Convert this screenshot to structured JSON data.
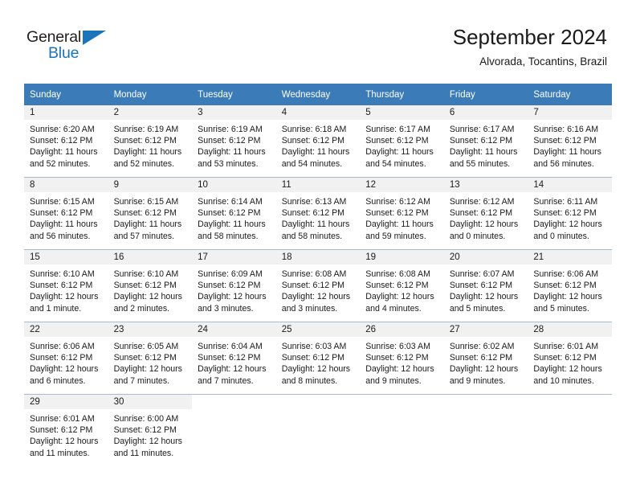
{
  "brand": {
    "name_part1": "General",
    "name_part2": "Blue",
    "accent_color": "#1b75bb"
  },
  "header": {
    "title": "September 2024",
    "location": "Alvorada, Tocantins, Brazil",
    "header_bg_color": "#3b7cb8",
    "daynum_bg_color": "#f1f1f1"
  },
  "weekdays": [
    "Sunday",
    "Monday",
    "Tuesday",
    "Wednesday",
    "Thursday",
    "Friday",
    "Saturday"
  ],
  "weeks": [
    [
      {
        "day": "1",
        "sunrise": "Sunrise: 6:20 AM",
        "sunset": "Sunset: 6:12 PM",
        "daylight1": "Daylight: 11 hours",
        "daylight2": "and 52 minutes."
      },
      {
        "day": "2",
        "sunrise": "Sunrise: 6:19 AM",
        "sunset": "Sunset: 6:12 PM",
        "daylight1": "Daylight: 11 hours",
        "daylight2": "and 52 minutes."
      },
      {
        "day": "3",
        "sunrise": "Sunrise: 6:19 AM",
        "sunset": "Sunset: 6:12 PM",
        "daylight1": "Daylight: 11 hours",
        "daylight2": "and 53 minutes."
      },
      {
        "day": "4",
        "sunrise": "Sunrise: 6:18 AM",
        "sunset": "Sunset: 6:12 PM",
        "daylight1": "Daylight: 11 hours",
        "daylight2": "and 54 minutes."
      },
      {
        "day": "5",
        "sunrise": "Sunrise: 6:17 AM",
        "sunset": "Sunset: 6:12 PM",
        "daylight1": "Daylight: 11 hours",
        "daylight2": "and 54 minutes."
      },
      {
        "day": "6",
        "sunrise": "Sunrise: 6:17 AM",
        "sunset": "Sunset: 6:12 PM",
        "daylight1": "Daylight: 11 hours",
        "daylight2": "and 55 minutes."
      },
      {
        "day": "7",
        "sunrise": "Sunrise: 6:16 AM",
        "sunset": "Sunset: 6:12 PM",
        "daylight1": "Daylight: 11 hours",
        "daylight2": "and 56 minutes."
      }
    ],
    [
      {
        "day": "8",
        "sunrise": "Sunrise: 6:15 AM",
        "sunset": "Sunset: 6:12 PM",
        "daylight1": "Daylight: 11 hours",
        "daylight2": "and 56 minutes."
      },
      {
        "day": "9",
        "sunrise": "Sunrise: 6:15 AM",
        "sunset": "Sunset: 6:12 PM",
        "daylight1": "Daylight: 11 hours",
        "daylight2": "and 57 minutes."
      },
      {
        "day": "10",
        "sunrise": "Sunrise: 6:14 AM",
        "sunset": "Sunset: 6:12 PM",
        "daylight1": "Daylight: 11 hours",
        "daylight2": "and 58 minutes."
      },
      {
        "day": "11",
        "sunrise": "Sunrise: 6:13 AM",
        "sunset": "Sunset: 6:12 PM",
        "daylight1": "Daylight: 11 hours",
        "daylight2": "and 58 minutes."
      },
      {
        "day": "12",
        "sunrise": "Sunrise: 6:12 AM",
        "sunset": "Sunset: 6:12 PM",
        "daylight1": "Daylight: 11 hours",
        "daylight2": "and 59 minutes."
      },
      {
        "day": "13",
        "sunrise": "Sunrise: 6:12 AM",
        "sunset": "Sunset: 6:12 PM",
        "daylight1": "Daylight: 12 hours",
        "daylight2": "and 0 minutes."
      },
      {
        "day": "14",
        "sunrise": "Sunrise: 6:11 AM",
        "sunset": "Sunset: 6:12 PM",
        "daylight1": "Daylight: 12 hours",
        "daylight2": "and 0 minutes."
      }
    ],
    [
      {
        "day": "15",
        "sunrise": "Sunrise: 6:10 AM",
        "sunset": "Sunset: 6:12 PM",
        "daylight1": "Daylight: 12 hours",
        "daylight2": "and 1 minute."
      },
      {
        "day": "16",
        "sunrise": "Sunrise: 6:10 AM",
        "sunset": "Sunset: 6:12 PM",
        "daylight1": "Daylight: 12 hours",
        "daylight2": "and 2 minutes."
      },
      {
        "day": "17",
        "sunrise": "Sunrise: 6:09 AM",
        "sunset": "Sunset: 6:12 PM",
        "daylight1": "Daylight: 12 hours",
        "daylight2": "and 3 minutes."
      },
      {
        "day": "18",
        "sunrise": "Sunrise: 6:08 AM",
        "sunset": "Sunset: 6:12 PM",
        "daylight1": "Daylight: 12 hours",
        "daylight2": "and 3 minutes."
      },
      {
        "day": "19",
        "sunrise": "Sunrise: 6:08 AM",
        "sunset": "Sunset: 6:12 PM",
        "daylight1": "Daylight: 12 hours",
        "daylight2": "and 4 minutes."
      },
      {
        "day": "20",
        "sunrise": "Sunrise: 6:07 AM",
        "sunset": "Sunset: 6:12 PM",
        "daylight1": "Daylight: 12 hours",
        "daylight2": "and 5 minutes."
      },
      {
        "day": "21",
        "sunrise": "Sunrise: 6:06 AM",
        "sunset": "Sunset: 6:12 PM",
        "daylight1": "Daylight: 12 hours",
        "daylight2": "and 5 minutes."
      }
    ],
    [
      {
        "day": "22",
        "sunrise": "Sunrise: 6:06 AM",
        "sunset": "Sunset: 6:12 PM",
        "daylight1": "Daylight: 12 hours",
        "daylight2": "and 6 minutes."
      },
      {
        "day": "23",
        "sunrise": "Sunrise: 6:05 AM",
        "sunset": "Sunset: 6:12 PM",
        "daylight1": "Daylight: 12 hours",
        "daylight2": "and 7 minutes."
      },
      {
        "day": "24",
        "sunrise": "Sunrise: 6:04 AM",
        "sunset": "Sunset: 6:12 PM",
        "daylight1": "Daylight: 12 hours",
        "daylight2": "and 7 minutes."
      },
      {
        "day": "25",
        "sunrise": "Sunrise: 6:03 AM",
        "sunset": "Sunset: 6:12 PM",
        "daylight1": "Daylight: 12 hours",
        "daylight2": "and 8 minutes."
      },
      {
        "day": "26",
        "sunrise": "Sunrise: 6:03 AM",
        "sunset": "Sunset: 6:12 PM",
        "daylight1": "Daylight: 12 hours",
        "daylight2": "and 9 minutes."
      },
      {
        "day": "27",
        "sunrise": "Sunrise: 6:02 AM",
        "sunset": "Sunset: 6:12 PM",
        "daylight1": "Daylight: 12 hours",
        "daylight2": "and 9 minutes."
      },
      {
        "day": "28",
        "sunrise": "Sunrise: 6:01 AM",
        "sunset": "Sunset: 6:12 PM",
        "daylight1": "Daylight: 12 hours",
        "daylight2": "and 10 minutes."
      }
    ],
    [
      {
        "day": "29",
        "sunrise": "Sunrise: 6:01 AM",
        "sunset": "Sunset: 6:12 PM",
        "daylight1": "Daylight: 12 hours",
        "daylight2": "and 11 minutes."
      },
      {
        "day": "30",
        "sunrise": "Sunrise: 6:00 AM",
        "sunset": "Sunset: 6:12 PM",
        "daylight1": "Daylight: 12 hours",
        "daylight2": "and 11 minutes."
      },
      {
        "day": "",
        "sunrise": "",
        "sunset": "",
        "daylight1": "",
        "daylight2": ""
      },
      {
        "day": "",
        "sunrise": "",
        "sunset": "",
        "daylight1": "",
        "daylight2": ""
      },
      {
        "day": "",
        "sunrise": "",
        "sunset": "",
        "daylight1": "",
        "daylight2": ""
      },
      {
        "day": "",
        "sunrise": "",
        "sunset": "",
        "daylight1": "",
        "daylight2": ""
      },
      {
        "day": "",
        "sunrise": "",
        "sunset": "",
        "daylight1": "",
        "daylight2": ""
      }
    ]
  ]
}
